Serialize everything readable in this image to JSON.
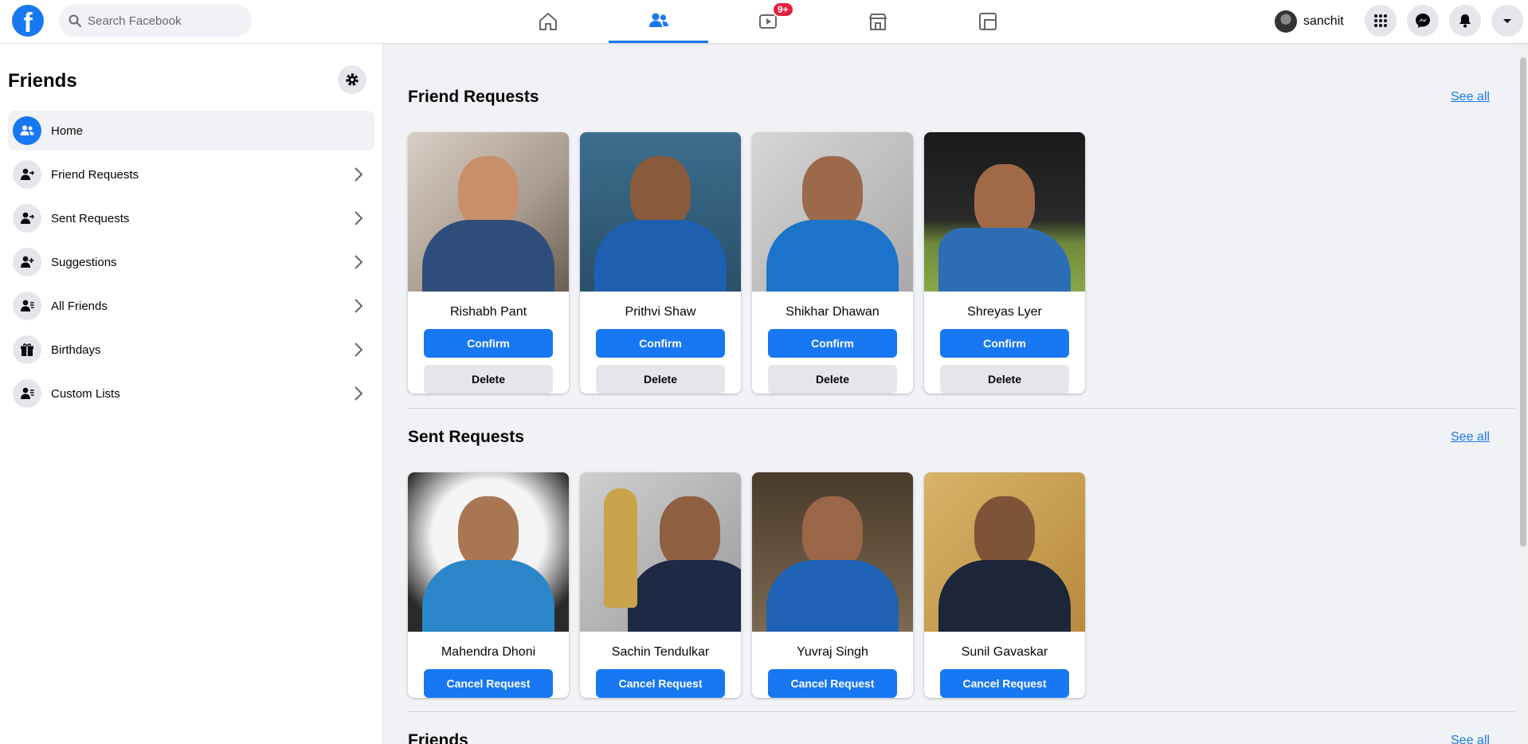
{
  "header": {
    "logo_letter": "f",
    "search_placeholder": "Search Facebook",
    "nav_tabs": [
      {
        "name": "home",
        "icon": "home-icon",
        "active": false
      },
      {
        "name": "friends",
        "icon": "friends-icon",
        "active": true
      },
      {
        "name": "watch",
        "icon": "video-icon",
        "active": false,
        "badge": "9+"
      },
      {
        "name": "marketplace",
        "icon": "store-icon",
        "active": false
      },
      {
        "name": "groups",
        "icon": "groups-icon",
        "active": false
      }
    ],
    "profile_name": "sanchit",
    "right_icons": [
      "menu-grid-icon",
      "messenger-icon",
      "bell-icon",
      "caret-down-icon"
    ],
    "accent_color": "#1877f2",
    "badge_color": "#e41e3f"
  },
  "sidebar": {
    "title": "Friends",
    "items": [
      {
        "label": "Home",
        "icon": "friends-icon",
        "active": true
      },
      {
        "label": "Friend Requests",
        "icon": "user-arrow-icon"
      },
      {
        "label": "Sent Requests",
        "icon": "user-arrow-icon"
      },
      {
        "label": "Suggestions",
        "icon": "user-plus-icon"
      },
      {
        "label": "All Friends",
        "icon": "user-list-icon"
      },
      {
        "label": "Birthdays",
        "icon": "gift-icon"
      },
      {
        "label": "Custom Lists",
        "icon": "user-list-icon"
      }
    ]
  },
  "main": {
    "friend_requests": {
      "title": "Friend Requests",
      "see_all": "See all",
      "confirm_label": "Confirm",
      "delete_label": "Delete",
      "people": [
        {
          "name": "Rishabh Pant"
        },
        {
          "name": "Prithvi Shaw"
        },
        {
          "name": "Shikhar Dhawan"
        },
        {
          "name": "Shreyas Lyer"
        }
      ]
    },
    "sent_requests": {
      "title": "Sent Requests",
      "see_all": "See all",
      "cancel_label": "Cancel Request",
      "people": [
        {
          "name": "Mahendra Dhoni"
        },
        {
          "name": "Sachin Tendulkar"
        },
        {
          "name": "Yuvraj Singh"
        },
        {
          "name": "Sunil Gavaskar"
        }
      ]
    },
    "friends": {
      "title": "Friends",
      "see_all": "See all"
    }
  }
}
